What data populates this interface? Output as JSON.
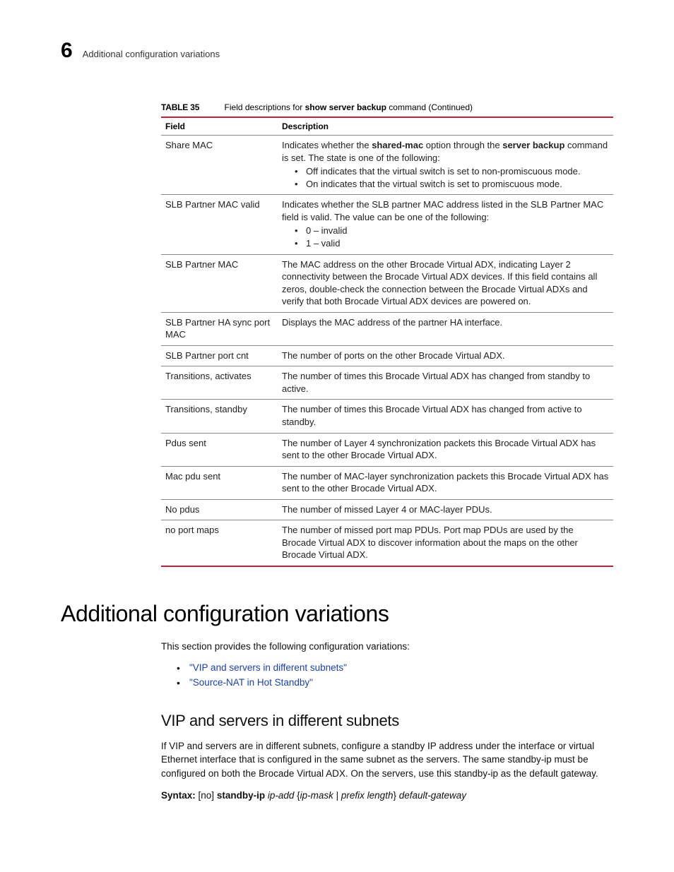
{
  "header": {
    "chapter": "6",
    "running_head": "Additional configuration variations"
  },
  "table": {
    "label": "TABLE 35",
    "caption_pre": "Field descriptions for ",
    "caption_cmd": "show server backup",
    "caption_post": " command (Continued)",
    "col_field": "Field",
    "col_desc": "Description"
  },
  "rows": {
    "share_mac": {
      "field": "Share MAC",
      "pre": "Indicates whether the ",
      "b1": "shared-mac",
      "mid": " option through the ",
      "b2": "server backup",
      "post": " command is set. The state is one of the following:",
      "li1": "Off indicates that the virtual switch is set to non-promiscuous mode.",
      "li2": "On indicates that the virtual switch is set to promiscuous mode."
    },
    "slb_valid": {
      "field": "SLB Partner MAC valid",
      "desc": "Indicates whether the SLB partner MAC address listed in the SLB Partner MAC field is valid. The value can be one of the following:",
      "li1": "0 – invalid",
      "li2": "1 – valid"
    },
    "slb_mac": {
      "field": "SLB Partner MAC",
      "desc": "The MAC address on the other Brocade Virtual ADX, indicating Layer 2 connectivity between the Brocade Virtual ADX devices. If this field contains all zeros, double-check the connection between the Brocade Virtual ADXs and verify that both Brocade Virtual ADX devices are powered on."
    },
    "ha_sync": {
      "field": "SLB Partner HA sync port MAC",
      "desc": "Displays the MAC address of the partner HA interface."
    },
    "port_cnt": {
      "field": "SLB Partner port cnt",
      "desc": "The number of ports on the other Brocade Virtual ADX."
    },
    "trans_act": {
      "field": "Transitions, activates",
      "desc": "The number of times this Brocade Virtual ADX has changed from standby to active."
    },
    "trans_stby": {
      "field": "Transitions, standby",
      "desc": "The number of times this Brocade Virtual ADX has changed from active to standby."
    },
    "pdus_sent": {
      "field": "Pdus sent",
      "desc": "The number of Layer 4 synchronization packets this Brocade Virtual ADX has sent to the other Brocade Virtual ADX."
    },
    "mac_pdu": {
      "field": "Mac pdu sent",
      "desc": "The number of MAC-layer synchronization packets this Brocade Virtual ADX has sent to the other Brocade Virtual ADX."
    },
    "no_pdus": {
      "field": "No pdus",
      "desc": "The number of missed Layer 4 or MAC-layer PDUs."
    },
    "no_port_maps": {
      "field": "no port maps",
      "desc": "The number of missed port map PDUs. Port map PDUs are used by the Brocade Virtual ADX to discover information about the maps on the other Brocade Virtual ADX."
    }
  },
  "section": {
    "h1": "Additional configuration variations",
    "intro": "This section provides the following configuration variations:",
    "link1": "\"VIP and servers in different subnets\"",
    "link2": "\"Source-NAT in Hot Standby\"",
    "h2": "VIP and servers in different subnets",
    "para": "If VIP and servers are in different subnets, configure a standby IP address under the interface or virtual Ethernet interface that is configured in the same subnet as the servers. The same standby-ip must be configured on both the Brocade Virtual ADX. On the servers, use this standby-ip as the default gateway.",
    "syntax_label": "Syntax:",
    "syntax_no": " [no] ",
    "syntax_kw": "standby-ip",
    "syntax_arg1": " ip-add",
    "syntax_brace_open": " {",
    "syntax_arg2": "ip-mask",
    "syntax_pipe": " | ",
    "syntax_arg3": "prefix length",
    "syntax_brace_close": "} ",
    "syntax_arg4": "default-gateway"
  }
}
